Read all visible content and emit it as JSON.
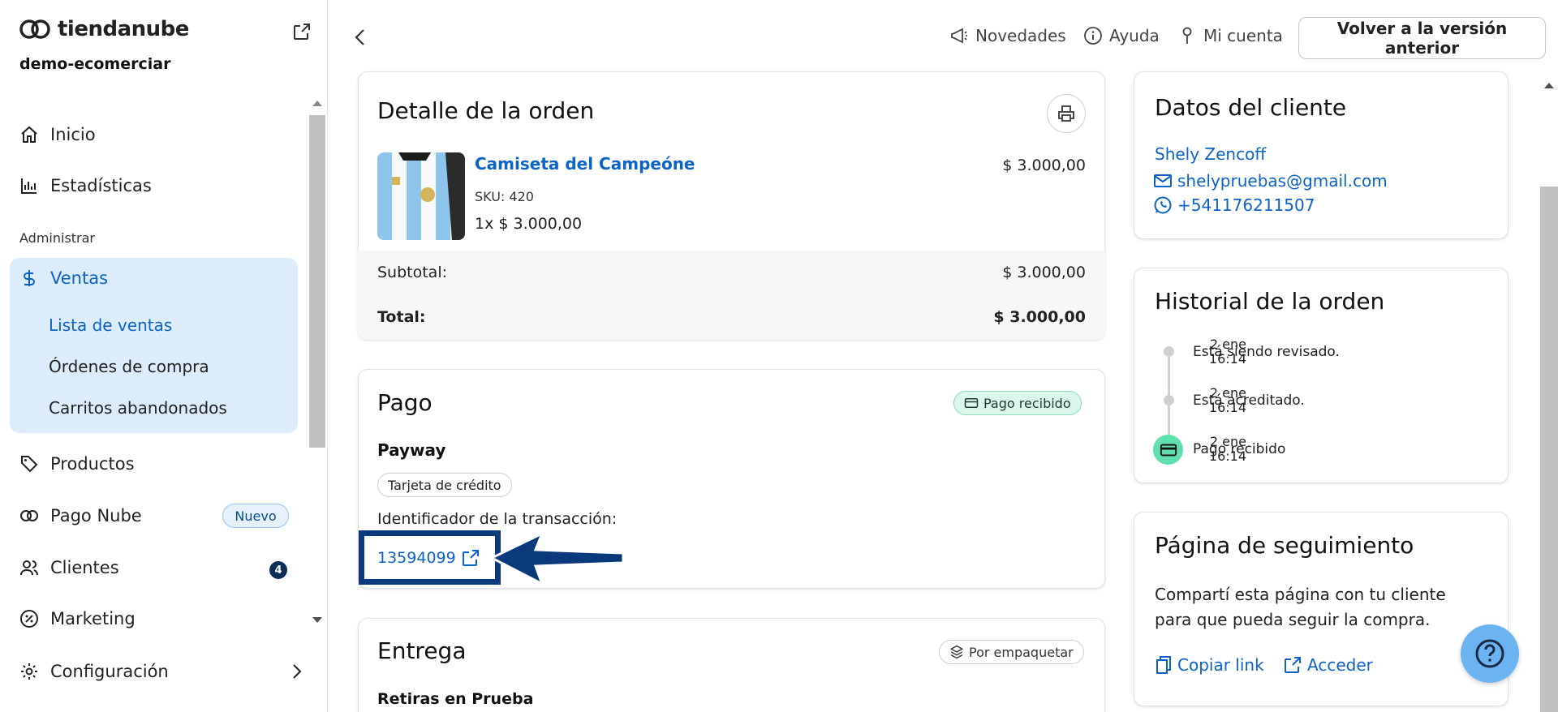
{
  "brand": {
    "name": "tiendanube",
    "store": "demo-ecomerciar"
  },
  "sidebar": {
    "items": [
      {
        "label": "Inicio",
        "icon": "home-icon"
      },
      {
        "label": "Estadísticas",
        "icon": "bar-chart-icon"
      },
      {
        "label": "Ventas",
        "icon": "dollar-icon"
      },
      {
        "label": "Productos",
        "icon": "tag-icon"
      },
      {
        "label": "Pago Nube",
        "icon": "pago-nube-icon"
      },
      {
        "label": "Clientes",
        "icon": "users-icon"
      },
      {
        "label": "Marketing",
        "icon": "percent-icon"
      },
      {
        "label": "Configuración",
        "icon": "gear-icon"
      }
    ],
    "section_label": "Administrar",
    "ventas_sub": [
      "Lista de ventas",
      "Órdenes de compra",
      "Carritos abandonados"
    ],
    "pago_nube_badge": "Nuevo",
    "clientes_count": "4"
  },
  "topbar": {
    "novedades": "Novedades",
    "ayuda": "Ayuda",
    "mi_cuenta": "Mi cuenta",
    "prev_version": "Volver a la versión anterior"
  },
  "order": {
    "title": "Detalle de la orden",
    "product_name": "Camiseta del Campeóne",
    "sku": "SKU: 420",
    "qty_price": "1x $ 3.000,00",
    "price": "$ 3.000,00",
    "subtotal_label": "Subtotal:",
    "subtotal_value": "$ 3.000,00",
    "total_label": "Total:",
    "total_value": "$ 3.000,00"
  },
  "payment": {
    "title": "Pago",
    "status": "Pago recibido",
    "method": "Payway",
    "type": "Tarjeta de crédito",
    "txn_label": "Identificador de la transacción:",
    "txn_id": "13594099"
  },
  "delivery": {
    "title": "Entrega",
    "status": "Por empaquetar",
    "location": "Retiras en Prueba"
  },
  "client": {
    "title": "Datos del cliente",
    "name": "Shely Zencoff",
    "email": "shelypruebas@gmail.com",
    "phone": "+541176211507"
  },
  "history": {
    "title": "Historial de la orden",
    "events": [
      {
        "text": "Está siendo revisado.",
        "date": "2 ene",
        "time": "16:14"
      },
      {
        "text": "Está acreditado.",
        "date": "2 ene",
        "time": "16:14"
      },
      {
        "text": "Pago recibido",
        "date": "2 ene",
        "time": "16:14"
      }
    ]
  },
  "tracking": {
    "title": "Página de seguimiento",
    "text": "Compartí esta página con tu cliente para que pueda seguir la compra.",
    "copy_link": "Copiar link",
    "access": "Acceder"
  },
  "colors": {
    "link": "#0c63c7",
    "active_bg": "#dcecfa",
    "success_bg": "#dbf6ea",
    "highlight": "#0a3a7c"
  }
}
